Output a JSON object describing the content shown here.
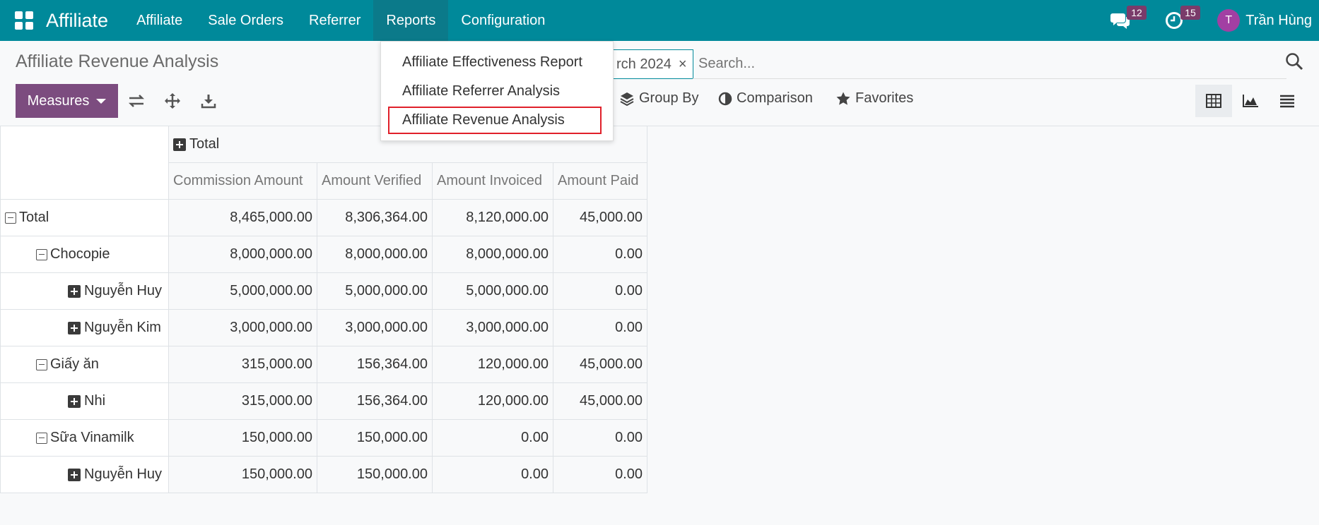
{
  "navbar": {
    "brand": "Affiliate",
    "menu": [
      "Affiliate",
      "Sale Orders",
      "Referrer",
      "Reports",
      "Configuration"
    ],
    "messages_count": "12",
    "activities_count": "15",
    "avatar_initial": "T",
    "user_name": "Trần Hùng",
    "bg_color": "#00899a"
  },
  "reports_menu": {
    "items": [
      "Affiliate Effectiveness Report",
      "Affiliate Referrer Analysis",
      "Affiliate Revenue Analysis"
    ],
    "highlighted": "Affiliate Revenue Analysis"
  },
  "control_panel": {
    "title": "Affiliate Revenue Analysis",
    "measures_label": "Measures",
    "facet_label": "rch 2024",
    "facet_close": "×",
    "search_placeholder": "Search...",
    "group_by_label": "Group By",
    "comparison_label": "Comparison",
    "favorites_label": "Favorites",
    "views": [
      "pivot",
      "graph",
      "list"
    ],
    "active_view": "pivot"
  },
  "pivot": {
    "column_group": "Total",
    "measures": [
      "Commission Amount",
      "Amount Verified",
      "Amount Invoiced",
      "Amount Paid"
    ],
    "rows": [
      {
        "label": "Total",
        "level": 0,
        "icon": "minus",
        "values": [
          "8,465,000.00",
          "8,306,364.00",
          "8,120,000.00",
          "45,000.00"
        ]
      },
      {
        "label": "Chocopie",
        "level": 1,
        "icon": "minus",
        "values": [
          "8,000,000.00",
          "8,000,000.00",
          "8,000,000.00",
          "0.00"
        ]
      },
      {
        "label": "Nguyễn Huy",
        "level": 2,
        "icon": "plus",
        "values": [
          "5,000,000.00",
          "5,000,000.00",
          "5,000,000.00",
          "0.00"
        ]
      },
      {
        "label": "Nguyễn Kim",
        "level": 2,
        "icon": "plus",
        "values": [
          "3,000,000.00",
          "3,000,000.00",
          "3,000,000.00",
          "0.00"
        ]
      },
      {
        "label": "Giấy ăn",
        "level": 1,
        "icon": "minus",
        "values": [
          "315,000.00",
          "156,364.00",
          "120,000.00",
          "45,000.00"
        ]
      },
      {
        "label": "Nhi",
        "level": 2,
        "icon": "plus",
        "values": [
          "315,000.00",
          "156,364.00",
          "120,000.00",
          "45,000.00"
        ]
      },
      {
        "label": "Sữa Vinamilk",
        "level": 1,
        "icon": "minus",
        "values": [
          "150,000.00",
          "150,000.00",
          "0.00",
          "0.00"
        ]
      },
      {
        "label": "Nguyễn Huy",
        "level": 2,
        "icon": "plus",
        "values": [
          "150,000.00",
          "150,000.00",
          "0.00",
          "0.00"
        ]
      }
    ]
  }
}
